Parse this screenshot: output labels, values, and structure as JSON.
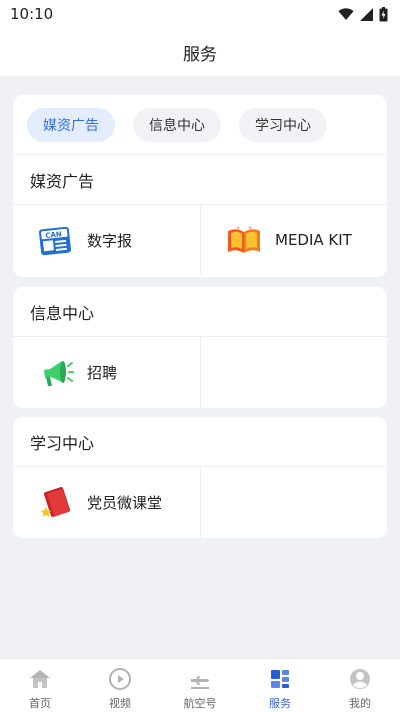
{
  "status": {
    "time": "10:10"
  },
  "header": {
    "title": "服务"
  },
  "tabs": [
    {
      "label": "媒资广告",
      "active": true
    },
    {
      "label": "信息中心",
      "active": false
    },
    {
      "label": "学习中心",
      "active": false
    }
  ],
  "sections": [
    {
      "title": "媒资广告",
      "items": [
        {
          "label": "数字报",
          "icon": "newspaper-can-icon",
          "icon_text": "CAN"
        },
        {
          "label": "MEDIA KIT",
          "icon": "open-book-icon"
        }
      ]
    },
    {
      "title": "信息中心",
      "items": [
        {
          "label": "招聘",
          "icon": "megaphone-icon"
        }
      ]
    },
    {
      "title": "学习中心",
      "items": [
        {
          "label": "党员微课堂",
          "icon": "red-book-star-icon"
        }
      ]
    }
  ],
  "bottom_nav": [
    {
      "label": "首页",
      "icon": "home-icon",
      "active": false
    },
    {
      "label": "视频",
      "icon": "play-circle-icon",
      "active": false
    },
    {
      "label": "航空号",
      "icon": "airplane-icon",
      "active": false
    },
    {
      "label": "服务",
      "icon": "grid-icon",
      "active": true
    },
    {
      "label": "我的",
      "icon": "profile-icon",
      "active": false
    }
  ],
  "colors": {
    "accent": "#3470e4",
    "active_tab_bg": "#e4edfd",
    "page_bg": "#f0f1f5"
  }
}
